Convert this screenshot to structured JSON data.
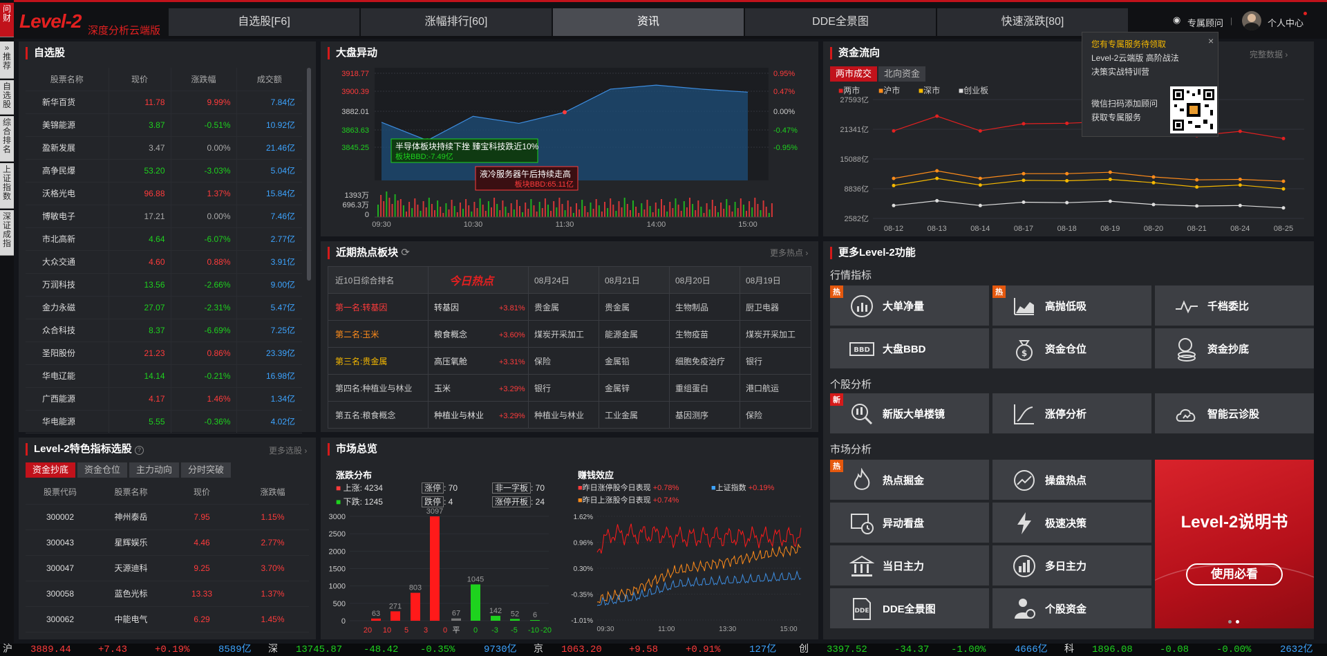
{
  "app": {
    "logo": "Level-2",
    "logo_sub": "深度分析云端版"
  },
  "nav": [
    "自选股[F6]",
    "涨幅排行[60]",
    "资讯",
    "DDE全景图",
    "快速涨跌[80]"
  ],
  "header_right": {
    "advisor": "专属顾问",
    "sep": "|",
    "user": "个人中心"
  },
  "side": [
    "问财",
    "推荐",
    "自选股",
    "综合排名",
    "上证指数",
    "深证成指"
  ],
  "watchlist": {
    "title": "自选股",
    "headers": [
      "股票名称",
      "现价",
      "涨跌幅",
      "成交额"
    ],
    "rows": [
      [
        "新华百货",
        "11.78",
        "9.99%",
        "7.84亿",
        "r"
      ],
      [
        "美锦能源",
        "3.87",
        "-0.51%",
        "10.92亿",
        "g"
      ],
      [
        "盈新发展",
        "3.47",
        "0.00%",
        "21.46亿",
        "n"
      ],
      [
        "高争民爆",
        "53.20",
        "-3.03%",
        "5.04亿",
        "g"
      ],
      [
        "沃格光电",
        "96.88",
        "1.37%",
        "15.84亿",
        "r"
      ],
      [
        "博敏电子",
        "17.21",
        "0.00%",
        "7.46亿",
        "n"
      ],
      [
        "市北高新",
        "4.64",
        "-6.07%",
        "2.77亿",
        "g"
      ],
      [
        "大众交通",
        "4.60",
        "0.88%",
        "3.91亿",
        "r"
      ],
      [
        "万润科技",
        "13.56",
        "-2.66%",
        "9.00亿",
        "g"
      ],
      [
        "金力永磁",
        "27.07",
        "-2.31%",
        "5.47亿",
        "g"
      ],
      [
        "众合科技",
        "8.37",
        "-6.69%",
        "7.25亿",
        "g"
      ],
      [
        "圣阳股份",
        "21.23",
        "0.86%",
        "23.39亿",
        "r"
      ],
      [
        "华电辽能",
        "14.14",
        "-0.21%",
        "16.98亿",
        "g"
      ],
      [
        "广西能源",
        "4.17",
        "1.46%",
        "1.34亿",
        "r"
      ],
      [
        "华电能源",
        "5.55",
        "-0.36%",
        "4.02亿",
        "g"
      ]
    ]
  },
  "picker": {
    "title": "Level-2特色指标选股",
    "more": "更多选股",
    "tabs": [
      "资金抄底",
      "资金仓位",
      "主力动向",
      "分时突破"
    ],
    "headers": [
      "股票代码",
      "股票名称",
      "现价",
      "涨跌幅"
    ],
    "rows": [
      [
        "300002",
        "神州泰岳",
        "7.95",
        "1.15%"
      ],
      [
        "300043",
        "星辉娱乐",
        "4.46",
        "2.77%"
      ],
      [
        "300047",
        "天源迪科",
        "9.25",
        "3.70%"
      ],
      [
        "300058",
        "蓝色光标",
        "13.33",
        "1.37%"
      ],
      [
        "300062",
        "中能电气",
        "6.29",
        "1.45%"
      ]
    ]
  },
  "market_move": {
    "title": "大盘异动",
    "y_left": [
      "3918.77",
      "3900.39",
      "3882.01",
      "3863.63",
      "3845.25"
    ],
    "y_right": [
      "0.95%",
      "0.47%",
      "0.00%",
      "-0.47%",
      "-0.95%"
    ],
    "vol_axis": [
      "1393万",
      "696.3万",
      "0"
    ],
    "x_labels": [
      "09:30",
      "10:30",
      "11:30",
      "14:00",
      "15:00"
    ],
    "annotations": [
      {
        "text": "半导体板块持续下挫 臻宝科技跌近10%",
        "sub": "板块BBD:-7.49亿"
      },
      {
        "text": "液冷服务器午后持续走高",
        "sub": "板块BBD:65.11亿"
      }
    ],
    "chart_data": {
      "type": "area",
      "x": [
        "09:30",
        "10:00",
        "10:30",
        "11:00",
        "11:30",
        "13:30",
        "14:00",
        "14:30",
        "15:00"
      ],
      "values": [
        3870,
        3852,
        3876,
        3869,
        3880,
        3903,
        3907,
        3903,
        3900
      ],
      "ylim": [
        3845.25,
        3918.77
      ]
    }
  },
  "hot_sectors": {
    "title": "近期热点板块",
    "more": "更多热点",
    "headers": [
      "近10日综合排名",
      "今日热点",
      "08月24日",
      "08月21日",
      "08月20日",
      "08月19日"
    ],
    "rows": [
      [
        "第一名:转基因",
        "转基因",
        "+3.81%",
        "贵金属",
        "贵金属",
        "生物制品",
        "厨卫电器"
      ],
      [
        "第二名:玉米",
        "粮食概念",
        "+3.60%",
        "煤炭开采加工",
        "能源金属",
        "生物疫苗",
        "煤炭开采加工"
      ],
      [
        "第三名:贵金属",
        "高压氧舱",
        "+3.31%",
        "保险",
        "金属铅",
        "细胞免疫治疗",
        "银行"
      ],
      [
        "第四名:种植业与林业",
        "玉米",
        "+3.29%",
        "银行",
        "金属锌",
        "重组蛋白",
        "港口航运"
      ],
      [
        "第五名:粮食概念",
        "种植业与林业",
        "+3.29%",
        "种植业与林业",
        "工业金属",
        "基因测序",
        "保险"
      ]
    ]
  },
  "overview": {
    "title": "市场总览",
    "dist_title": "涨跌分布",
    "up": "上涨: 4234",
    "down": "下跌: 1245",
    "limit_up_l": "涨停",
    "limit_up": ": 70",
    "limit_down_l": "跌停",
    "limit_down": ": 4",
    "one_l": "非一字板",
    "one": ": 70",
    "open_l": "涨停开板",
    "open": ": 24",
    "chart_data": {
      "type": "bar",
      "categories": [
        "20",
        "10",
        "5",
        "3",
        "0",
        "平",
        "0",
        "-3",
        "-5",
        "-10",
        "-20"
      ],
      "values": [
        63,
        271,
        803,
        3097,
        67,
        1045,
        142,
        52,
        6
      ],
      "ylim": [
        0,
        3000
      ]
    },
    "y_axis": [
      "3000",
      "2500",
      "2000",
      "1500",
      "1000",
      "500",
      "0"
    ],
    "x_axis": [
      "20",
      "10",
      "5",
      "3",
      "0",
      "平",
      "0",
      "-3",
      "-5",
      "-10",
      "-20"
    ],
    "bar_labels": [
      "63",
      "271",
      "803",
      "3097",
      "67",
      "1045",
      "142",
      "52",
      "6"
    ],
    "effect_title": "赚钱效应",
    "legend": [
      "昨日涨停股今日表现",
      "+0.78%",
      "上证指数",
      "+0.19%",
      "昨日上涨股今日表现",
      "+0.74%"
    ],
    "effect_y": [
      "1.62%",
      "0.96%",
      "0.30%",
      "-0.35%",
      "-1.01%"
    ],
    "effect_x": [
      "09:30",
      "11:00",
      "13:30",
      "15:00"
    ]
  },
  "fund_flow": {
    "title": "资金流向",
    "more": "完整数据",
    "tabs": [
      "两市成交",
      "北向资金"
    ],
    "legend": [
      "两市",
      "沪市",
      "深市",
      "创业板"
    ],
    "y_axis": [
      "27593亿",
      "21341亿",
      "15088亿",
      "8836亿",
      "2582亿"
    ],
    "x_axis": [
      "08-12",
      "08-13",
      "08-14",
      "08-17",
      "08-18",
      "08-19",
      "08-20",
      "08-21",
      "08-24",
      "08-25"
    ],
    "chart_data": {
      "type": "line",
      "x": [
        "08-12",
        "08-13",
        "08-14",
        "08-17",
        "08-18",
        "08-19",
        "08-20",
        "08-21",
        "08-24",
        "08-25"
      ],
      "ylim": [
        2582,
        27593
      ],
      "series": [
        {
          "name": "两市",
          "values": [
            21000,
            24100,
            21000,
            22500,
            22600,
            23000,
            22200,
            20000,
            20900,
            19400
          ]
        },
        {
          "name": "沪市",
          "values": [
            11000,
            12600,
            11000,
            12000,
            12000,
            12300,
            11300,
            10700,
            10800,
            10400
          ]
        },
        {
          "name": "深市",
          "values": [
            9500,
            11000,
            9600,
            10600,
            10500,
            10800,
            10100,
            9200,
            9600,
            8800
          ]
        },
        {
          "name": "创业板",
          "values": [
            5300,
            6300,
            5300,
            6000,
            5900,
            6200,
            5500,
            5200,
            5300,
            4800
          ]
        }
      ]
    }
  },
  "popup": {
    "l1": "您有专属服务待领取",
    "l2": "Level-2云端版 高阶战法",
    "l3": "决策实战特训营",
    "l4": "微信扫码添加顾问",
    "l5": "获取专属服务"
  },
  "features": {
    "title": "更多Level-2功能",
    "sec1": "行情指标",
    "sec2": "个股分析",
    "sec3": "市场分析",
    "b1": "大单净量",
    "b2": "高抛低吸",
    "b3": "千档委比",
    "b4": "大盘BBD",
    "b5": "资金仓位",
    "b6": "资金抄底",
    "b7": "新版大单楼镜",
    "b8": "涨停分析",
    "b9": "智能云诊股",
    "b10": "热点掘金",
    "b11": "操盘热点",
    "b12": "异动看盘",
    "b13": "极速决策",
    "b14": "当日主力",
    "b15": "多日主力",
    "b16": "DDE全景图",
    "b17": "个股资金",
    "hot": "热",
    "new": "新",
    "banner_title": "Level-2说明书",
    "banner_btn": "使用必看"
  },
  "ticker": [
    [
      "沪",
      "3889.44",
      "+7.43",
      "+0.19%",
      "8589亿"
    ],
    [
      "深",
      "13745.87",
      "-48.42",
      "-0.35%",
      "9730亿"
    ],
    [
      "京",
      "1063.20",
      "+9.58",
      "+0.91%",
      "127亿"
    ],
    [
      "创",
      "3397.52",
      "-34.37",
      "-1.00%",
      "4666亿"
    ],
    [
      "科",
      "1896.08",
      "-0.08",
      "-0.00%",
      "2632亿"
    ]
  ]
}
